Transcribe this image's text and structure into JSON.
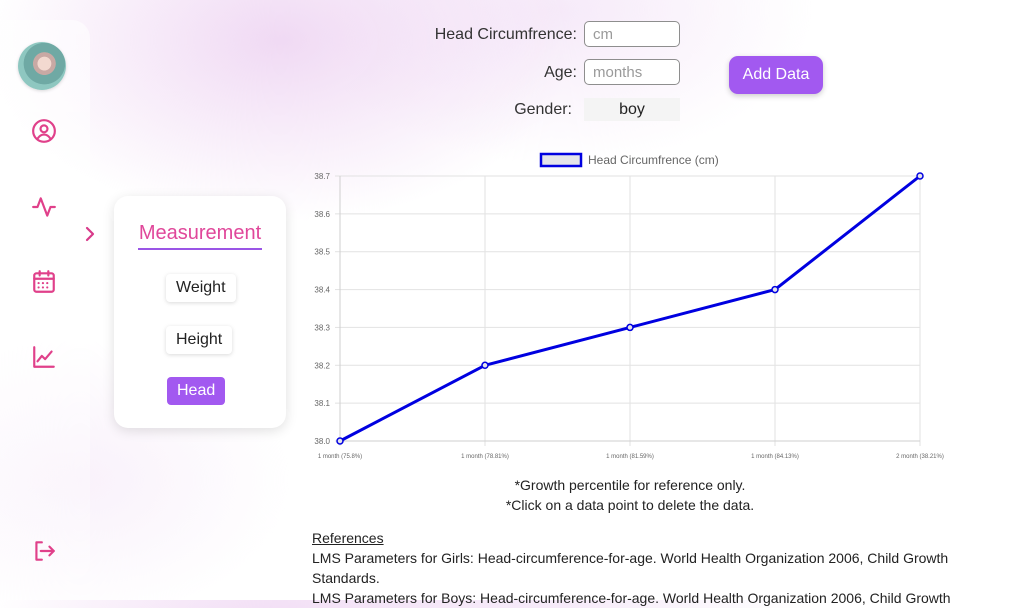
{
  "sidebar": {
    "avatar_alt": "profile",
    "icons": [
      "user-circle-icon",
      "activity-icon",
      "calendar-icon",
      "line-chart-icon"
    ],
    "logout_icon": "logout-icon",
    "accent_color": "#e0408a"
  },
  "measurement": {
    "title": "Measurement",
    "options": [
      "Weight",
      "Height",
      "Head"
    ],
    "active": "Head",
    "active_color": "#a259f0"
  },
  "form": {
    "head_label": "Head Circumfrence:",
    "head_placeholder": "cm",
    "age_label": "Age:",
    "age_placeholder": "months",
    "gender_label": "Gender:",
    "gender_value": "boy",
    "add_button": "Add Data"
  },
  "chart_data": {
    "type": "line",
    "legend": "Head Circumfrence (cm)",
    "categories": [
      "1 month (75.8%)",
      "1 month (78.81%)",
      "1 month (81.59%)",
      "1 month (84.13%)",
      "2 month (38.21%)"
    ],
    "values": [
      38.0,
      38.2,
      38.3,
      38.4,
      38.7
    ],
    "ylim": [
      38.0,
      38.7
    ],
    "yticks": [
      "38.0",
      "38.1",
      "38.2",
      "38.3",
      "38.4",
      "38.5",
      "38.6",
      "38.7"
    ],
    "grid": true,
    "legend_position": "top",
    "line_color": "#0000e0"
  },
  "notes": {
    "percentile": "*Growth percentile for reference only.",
    "delete": "*Click on a data point to delete the data."
  },
  "references": {
    "heading": "References",
    "girls": "LMS Parameters for Girls: Head-circumference-for-age. World Health Organization 2006, Child Growth Standards.",
    "boys": "LMS Parameters for Boys: Head-circumference-for-age. World Health Organization 2006, Child Growth"
  }
}
